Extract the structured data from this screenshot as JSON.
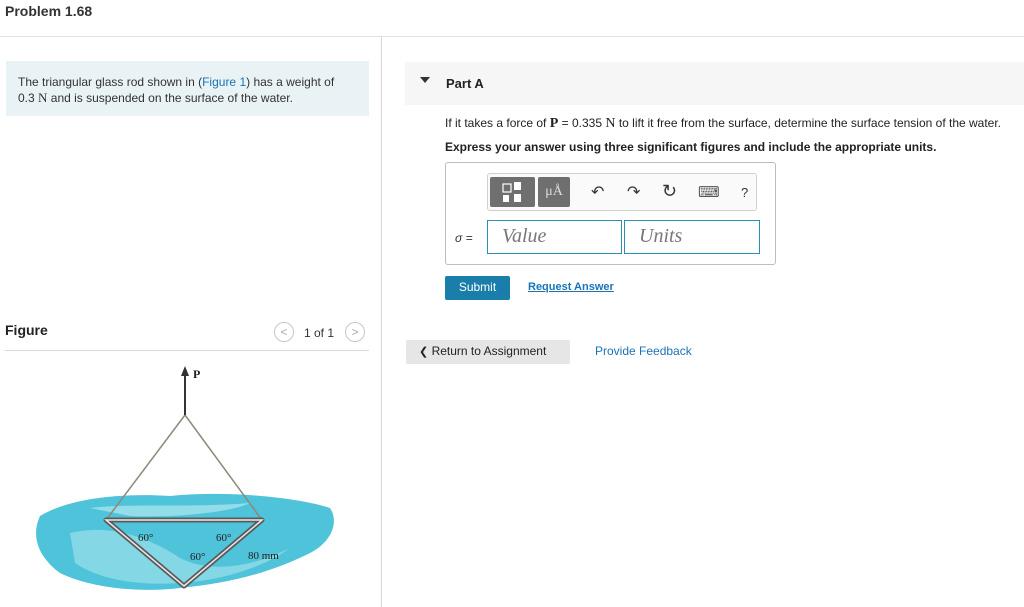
{
  "page_title": "Problem 1.68",
  "intro": {
    "text_before_link": "The triangular glass rod shown in (",
    "link_text": "Figure 1",
    "text_after_link": ") has a weight of",
    "line2_value": "0.3",
    "line2_unit": "N",
    "line2_rest": "and is suspended on the surface of the water."
  },
  "figure": {
    "label": "Figure",
    "pager": "1 of 1",
    "prev_glyph": "<",
    "next_glyph": ">",
    "labels": {
      "force": "P",
      "angle_left": "60°",
      "angle_right": "60°",
      "angle_bottom": "60°",
      "length": "80 mm"
    },
    "colors": {
      "water": "#4fc3d9",
      "water_light": "#9be0ea",
      "rod": "#5a5a5a"
    }
  },
  "part_a": {
    "label": "Part A",
    "question": {
      "prefix": "If it takes a force of",
      "symbol": "P",
      "equals_value": "= 0.335",
      "unit": "N",
      "suffix": "to lift it free from the surface, determine the surface tension of the water."
    },
    "instructions": "Express your answer using three significant figures and include the appropriate units.",
    "toolbar": {
      "units_button_label": "μÅ",
      "undo_glyph": "↶",
      "redo_glyph": "↷",
      "reset_glyph": "↻",
      "keyboard_glyph": "⌨",
      "help_glyph": "?"
    },
    "sigma_label": "σ =",
    "value_placeholder": "Value",
    "units_placeholder": "Units",
    "submit_label": "Submit",
    "request_answer_label": "Request Answer"
  },
  "footer": {
    "return_label": "Return to Assignment",
    "return_glyph": "❮",
    "feedback_label": "Provide Feedback"
  },
  "colors": {
    "accent": "#1a7eaa",
    "link": "#1a73b5",
    "intro_background": "#e9f2f5"
  }
}
